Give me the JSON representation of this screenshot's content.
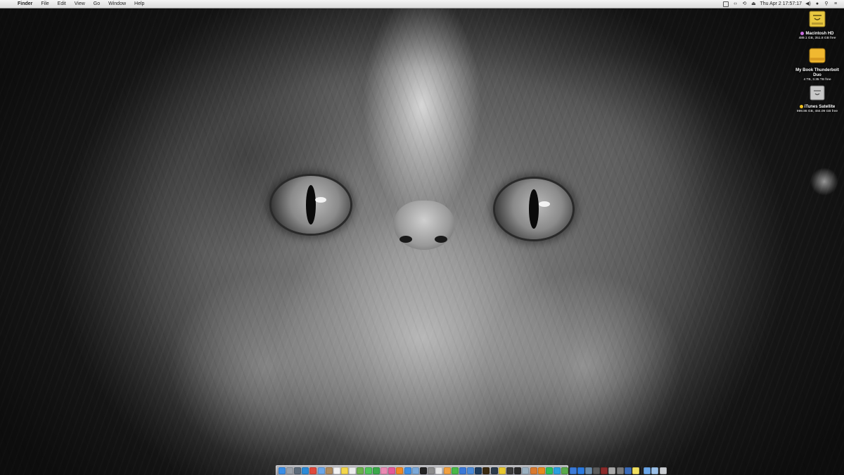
{
  "menubar": {
    "app_name": "Finder",
    "menus": [
      "File",
      "Edit",
      "View",
      "Go",
      "Window",
      "Help"
    ],
    "clock": "Thu Apr 2  17:57:17",
    "status_icons": [
      "dropbox-icon",
      "code-brackets-icon",
      "time-machine-icon",
      "eject-icon",
      "volume-icon",
      "user-icon",
      "spotlight-icon",
      "notification-center-icon"
    ]
  },
  "desktop": {
    "wallpaper": "grey-persian-cat-photo",
    "icons": [
      {
        "name": "Macintosh HD",
        "info": "489.1 GB, 351.8 GB free",
        "tag_color": "#c86ee0",
        "icon": "internal-drive-icon"
      },
      {
        "name": "My Book Thunderbolt Duo",
        "info": "4 TB, 3.35 TB free",
        "tag_color": "",
        "icon": "external-drive-icon"
      },
      {
        "name": "iTunes Satellite",
        "info": "999.86 GB, 484.09 GB free",
        "tag_color": "#f0c020",
        "icon": "network-drive-icon"
      }
    ]
  },
  "dock": {
    "apps": [
      {
        "icon": "finder-icon",
        "color": "#3a8ee6"
      },
      {
        "icon": "launchpad-icon",
        "color": "#9aa0a8"
      },
      {
        "icon": "mission-control-icon",
        "color": "#5c6b7a"
      },
      {
        "icon": "safari-icon",
        "color": "#2b8bd8"
      },
      {
        "icon": "chrome-icon",
        "color": "#e0493c"
      },
      {
        "icon": "mail-icon",
        "color": "#6aa6e8"
      },
      {
        "icon": "contacts-icon",
        "color": "#b08a5a"
      },
      {
        "icon": "calendar-icon",
        "color": "#f2f2f2"
      },
      {
        "icon": "notes-icon",
        "color": "#f3d64a"
      },
      {
        "icon": "reminders-icon",
        "color": "#ececec"
      },
      {
        "icon": "maps-icon",
        "color": "#6ab04c"
      },
      {
        "icon": "messages-icon",
        "color": "#4fc35a"
      },
      {
        "icon": "facetime-icon",
        "color": "#3aa84a"
      },
      {
        "icon": "photos-icon",
        "color": "#e98ab3"
      },
      {
        "icon": "itunes-icon",
        "color": "#e45a9a"
      },
      {
        "icon": "ibooks-icon",
        "color": "#f08a24"
      },
      {
        "icon": "app-store-icon",
        "color": "#3a8ee6"
      },
      {
        "icon": "preview-icon",
        "color": "#7aa8d8"
      },
      {
        "icon": "terminal-icon",
        "color": "#222222"
      },
      {
        "icon": "system-preferences-icon",
        "color": "#8c8c8c"
      },
      {
        "icon": "textedit-icon",
        "color": "#e8e8e8"
      },
      {
        "icon": "pages-icon",
        "color": "#f0a040"
      },
      {
        "icon": "numbers-icon",
        "color": "#48b848"
      },
      {
        "icon": "keynote-icon",
        "color": "#3a78d8"
      },
      {
        "icon": "xcode-icon",
        "color": "#4a8ad8"
      },
      {
        "icon": "photoshop-icon",
        "color": "#1d3a5a"
      },
      {
        "icon": "illustrator-icon",
        "color": "#3a2a10"
      },
      {
        "icon": "lightroom-icon",
        "color": "#2b3a4a"
      },
      {
        "icon": "radiation-icon",
        "color": "#e8c830"
      },
      {
        "icon": "activity-monitor-icon",
        "color": "#3a3a3a"
      },
      {
        "icon": "console-icon",
        "color": "#2a2a2a"
      },
      {
        "icon": "disk-utility-icon",
        "color": "#9ab0c0"
      },
      {
        "icon": "transmit-icon",
        "color": "#d87a30"
      },
      {
        "icon": "vlc-icon",
        "color": "#e88a20"
      },
      {
        "icon": "spotify-icon",
        "color": "#2cbf5a"
      },
      {
        "icon": "skype-icon",
        "color": "#2aa0e0"
      },
      {
        "icon": "evernote-icon",
        "color": "#5aaa4a"
      },
      {
        "icon": "1password-icon",
        "color": "#3a7ad8"
      },
      {
        "icon": "dropbox-app-icon",
        "color": "#2a7ae0"
      },
      {
        "icon": "quicktime-icon",
        "color": "#6a8aa8"
      },
      {
        "icon": "calculator-icon",
        "color": "#5a5a5a"
      },
      {
        "icon": "dictionary-icon",
        "color": "#8a2a2a"
      },
      {
        "icon": "font-book-icon",
        "color": "#a8a8a8"
      },
      {
        "icon": "automator-icon",
        "color": "#7a7a7a"
      },
      {
        "icon": "grapher-icon",
        "color": "#3a6ab8"
      },
      {
        "icon": "stickies-icon",
        "color": "#f0e060"
      }
    ],
    "trailing": [
      {
        "icon": "downloads-stack-icon",
        "color": "#6aa6e8"
      },
      {
        "icon": "documents-stack-icon",
        "color": "#9ac0e8"
      },
      {
        "icon": "trash-icon",
        "color": "#c8ccd0"
      }
    ]
  }
}
